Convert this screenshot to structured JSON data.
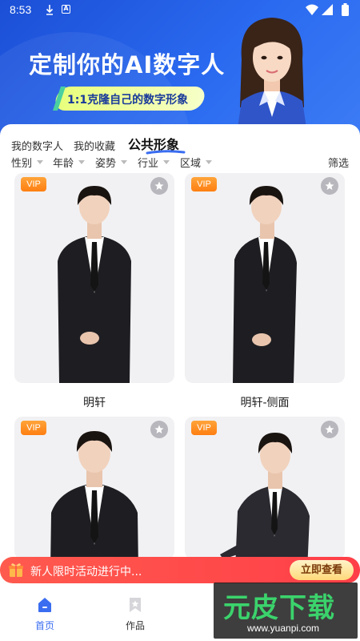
{
  "status_bar": {
    "time": "8:53"
  },
  "banner": {
    "title": "定制你的AI数字人",
    "subtitle": "1:1克隆自己的数字形象"
  },
  "tabs": [
    {
      "label": "我的数字人",
      "active": false
    },
    {
      "label": "我的收藏",
      "active": false
    },
    {
      "label": "公共形象",
      "active": true
    }
  ],
  "filters": [
    {
      "label": "性别"
    },
    {
      "label": "年龄"
    },
    {
      "label": "姿势"
    },
    {
      "label": "行业"
    },
    {
      "label": "区域"
    }
  ],
  "filter_screen_label": "筛选",
  "cards": [
    {
      "name": "明轩",
      "badge": "VIP"
    },
    {
      "name": "明轩-侧面",
      "badge": "VIP"
    },
    {
      "name": "",
      "badge": "VIP"
    },
    {
      "name": "",
      "badge": "VIP"
    }
  ],
  "promo": {
    "text": "新人限时活动进行中...",
    "button": "立即查看"
  },
  "bottom_nav": [
    {
      "label": "首页",
      "icon": "home-icon",
      "active": true
    },
    {
      "label": "作品",
      "icon": "works-icon",
      "active": false
    }
  ],
  "watermark": {
    "big": "元皮下载",
    "small": "www.yuanpi.com"
  },
  "colors": {
    "banner_blue": "#2a6af0",
    "accent_blue": "#3a6df0",
    "vip_orange": "#ff7f12",
    "promo_red": "#ff4a4a"
  }
}
